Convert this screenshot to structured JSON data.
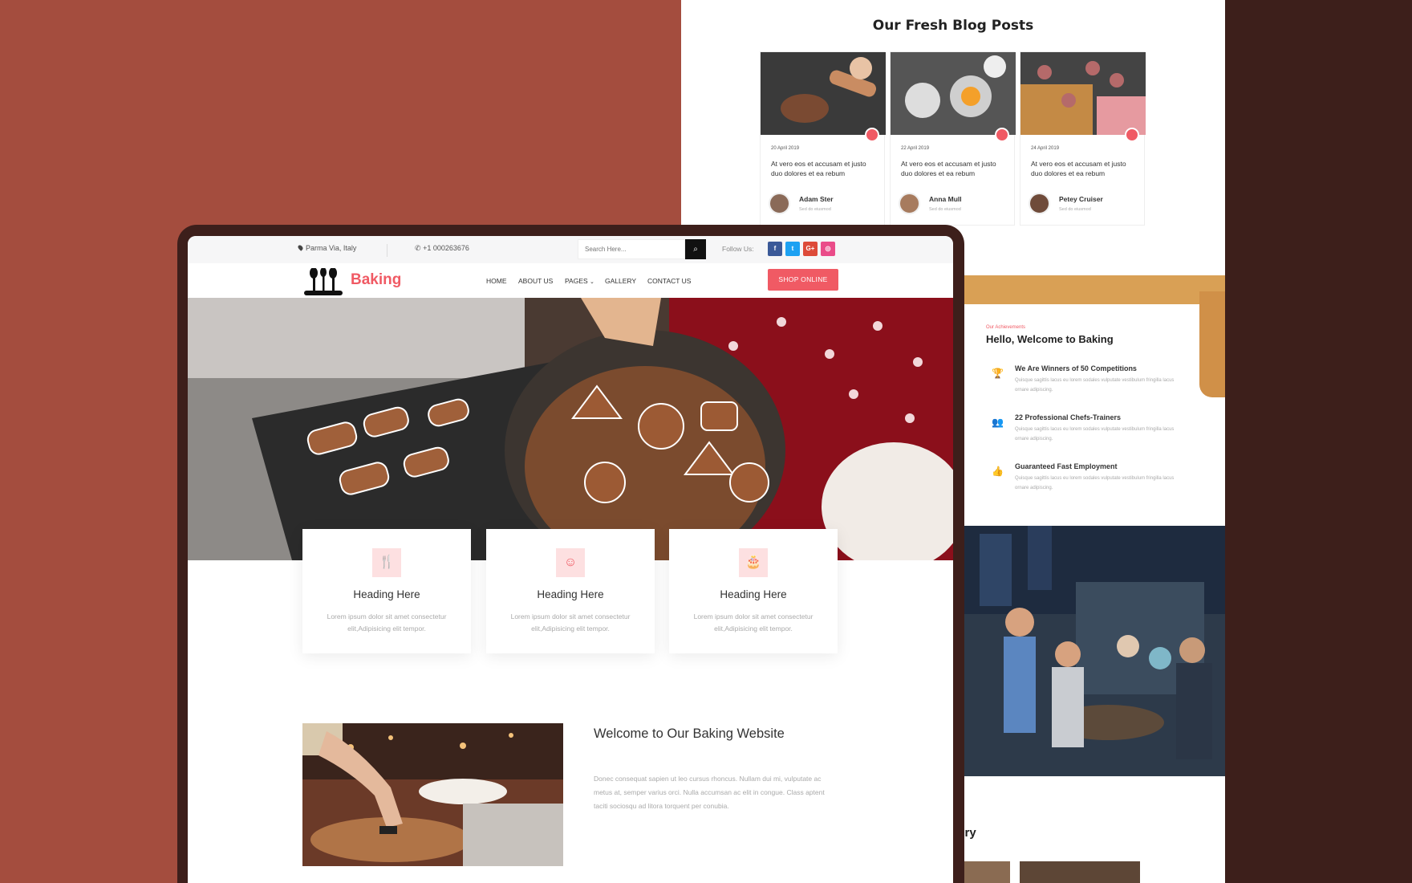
{
  "blog": {
    "title": "Our Fresh Blog Posts",
    "posts": [
      {
        "date": "20 April 2019",
        "text": "At vero eos et accusam et justo duo dolores et ea rebum",
        "author": "Adam Ster",
        "sub": "Sed do eiusmod"
      },
      {
        "date": "22 April 2019",
        "text": "At vero eos et accusam et justo duo dolores et ea rebum",
        "author": "Anna Mull",
        "sub": "Sed do eiusmod"
      },
      {
        "date": "24 April 2019",
        "text": "At vero eos et accusam et justo duo dolores et ea rebum",
        "author": "Petey Cruiser",
        "sub": "Sed do eiusmod"
      }
    ]
  },
  "achievements": {
    "kicker": "Our Achievements",
    "title": "Hello, Welcome to Baking",
    "items": [
      {
        "icon": "trophy-icon",
        "title": "We Are Winners of 50 Competitions",
        "text": "Quisque sagittis lacus eu lorem sodales vulputate vestibulum fringilla lacus ornare adipiscing."
      },
      {
        "icon": "people-icon",
        "title": "22 Professional Chefs-Trainers",
        "text": "Quisque sagittis lacus eu lorem sodales vulputate vestibulum fringilla lacus ornare adipiscing."
      },
      {
        "icon": "thumbs-up-icon",
        "title": "Guaranteed Fast Employment",
        "text": "Quisque sagittis lacus eu lorem sodales vulputate vestibulum fringilla lacus ornare adipiscing."
      }
    ]
  },
  "gallery": {
    "title_fragment": "lery"
  },
  "topbar": {
    "location": "Parma Via, Italy",
    "phone": "+1 000263676",
    "search_placeholder": "Search Here...",
    "search_icon": "search-icon",
    "follow_label": "Follow Us:",
    "socials": [
      {
        "name": "facebook-icon",
        "glyph": "f",
        "color": "#3b5998"
      },
      {
        "name": "twitter-icon",
        "glyph": "t",
        "color": "#1da1f2"
      },
      {
        "name": "google-plus-icon",
        "glyph": "G+",
        "color": "#dd4b39"
      },
      {
        "name": "dribbble-icon",
        "glyph": "◎",
        "color": "#ea4c89"
      }
    ]
  },
  "navbar": {
    "brand": "Baking",
    "items": [
      "HOME",
      "ABOUT US",
      "PAGES",
      "GALLERY",
      "CONTACT US"
    ],
    "shop_label": "SHOP ONLINE"
  },
  "features": [
    {
      "icon": "utensils-icon",
      "glyph": "🍴",
      "title": "Heading Here",
      "text": "Lorem ipsum dolor sit amet consectetur elit,Adipisicing elit tempor."
    },
    {
      "icon": "smile-icon",
      "glyph": "☺",
      "title": "Heading Here",
      "text": "Lorem ipsum dolor sit amet consectetur elit,Adipisicing elit tempor."
    },
    {
      "icon": "birthday-cake-icon",
      "glyph": "🎂",
      "title": "Heading Here",
      "text": "Lorem ipsum dolor sit amet consectetur elit,Adipisicing elit tempor."
    }
  ],
  "welcome": {
    "title": "Welcome to Our Baking Website",
    "text": "Donec consequat sapien ut leo cursus rhoncus. Nullam dui mi, vulputate ac metus at, semper varius orci. Nulla accumsan ac elit in congue. Class aptent taciti sociosqu ad litora torquent per conubia."
  },
  "colors": {
    "accent": "#f05a64",
    "left_bg": "#a44d3e",
    "right_bg": "#3d1f1b"
  }
}
